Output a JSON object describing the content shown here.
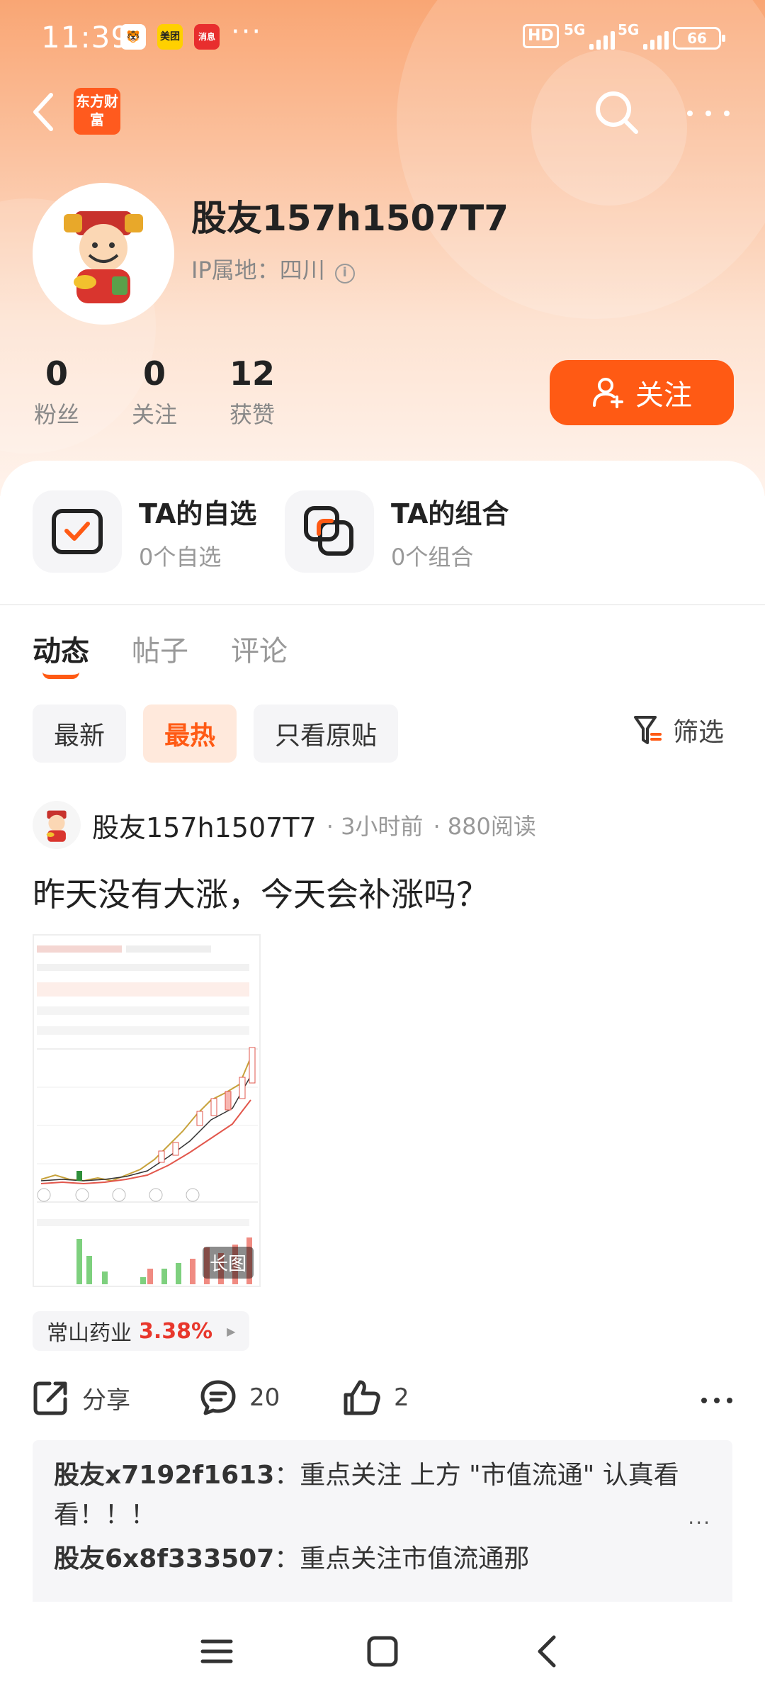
{
  "status_bar": {
    "time": "11:39",
    "notif_1": "🐯",
    "notif_2": "美团",
    "notif_3": "消息",
    "more": "···",
    "hd": "HD",
    "network_1": "5G",
    "network_2": "5G",
    "battery": "66"
  },
  "nav": {
    "logo_text": "东方财富"
  },
  "profile": {
    "username": "股友157h1507T7",
    "ip_label": "IP属地：四川",
    "stats": [
      {
        "value": "0",
        "label": "粉丝"
      },
      {
        "value": "0",
        "label": "关注"
      },
      {
        "value": "12",
        "label": "获赞"
      }
    ],
    "follow_label": "关注"
  },
  "shortcuts": [
    {
      "title": "TA的自选",
      "subtitle": "0个自选",
      "icon": "watchlist-icon"
    },
    {
      "title": "TA的组合",
      "subtitle": "0个组合",
      "icon": "portfolio-icon"
    }
  ],
  "tabs": [
    "动态",
    "帖子",
    "评论"
  ],
  "filters": [
    "最新",
    "最热",
    "只看原贴"
  ],
  "filter_button": "筛选",
  "post": {
    "author": "股友157h1507T7",
    "time": "· 3小时前",
    "reads": "· 880阅读",
    "text": "昨天没有大涨，今天会补涨吗？",
    "image_badge": "长图",
    "stock_name": "常山药业",
    "stock_change": "3.38%",
    "share_label": "分享",
    "comment_count": "20",
    "like_count": "2"
  },
  "comments": [
    {
      "author": "股友x7192f1613",
      "text": "重点关注 上方 \"市值流通\" 认真看看！！！"
    },
    {
      "author": "股友6x8f333507",
      "text": "重点关注市值流通那"
    }
  ],
  "colors": {
    "accent": "#ff5a14",
    "up": "#e8372c"
  }
}
